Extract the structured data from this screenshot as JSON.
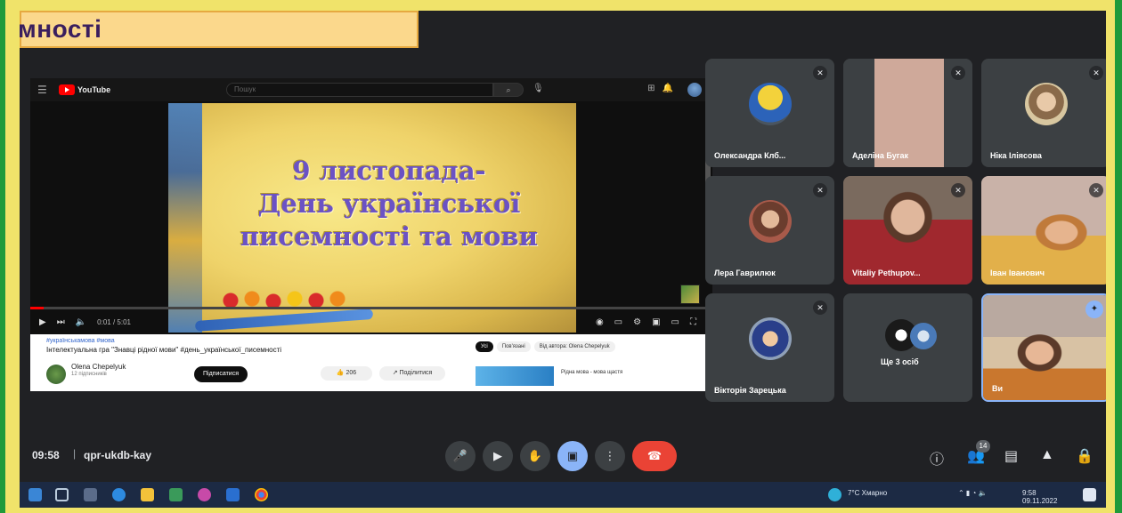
{
  "banner": {
    "text": "мності"
  },
  "youtube": {
    "brand": "YouTube",
    "search_placeholder": "Пошук",
    "slide_title_line1": "9 листопада-",
    "slide_title_line2": "День української",
    "slide_title_line3": "писемності та мови",
    "progress": 0.02,
    "time": "0:01 / 5:01",
    "hashtag": "#українськамова #мова",
    "video_title": "Інтелектуальна гра \"Знавці рідної мови\" #день_української_писемності",
    "channel": "Olena Chepelyuk",
    "channel_sub": "12 підписників",
    "subscribe": "Підписатися",
    "like": "👍 206",
    "share": "↗ Поділитися",
    "chips": [
      "Усі",
      "Пов'язані",
      "Від автора: Olena Chepelyuk"
    ],
    "rec_text": "Рідна мова - мова щастя"
  },
  "participants": [
    {
      "name": "Олександра Клб...",
      "muted": true,
      "avatar": "ukraine-map"
    },
    {
      "name": "Аделіна Бугак",
      "muted": true,
      "avatar": "camera-feed"
    },
    {
      "name": "Ніка Іліясова",
      "muted": true,
      "avatar": "photo"
    },
    {
      "name": "Лера Гаврилюк",
      "muted": true,
      "avatar": "photo"
    },
    {
      "name": "Vitaliy Pethupov...",
      "muted": true,
      "avatar": "camera-feed"
    },
    {
      "name": "Іван Іванович",
      "muted": true,
      "avatar": "camera-feed"
    },
    {
      "name": "Вікторія Зарецька",
      "muted": true,
      "avatar": "photo"
    },
    {
      "name": "Ще 3 осіб",
      "muted": false,
      "avatar": "group"
    },
    {
      "name": "Ви",
      "muted": false,
      "avatar": "camera-feed"
    }
  ],
  "meeting": {
    "time": "09:58",
    "separator": "|",
    "code": "qpr-ukdb-kay",
    "participant_count": "14",
    "end_call_color": "#ea4335",
    "accent": "#8ab4f8"
  },
  "controls": {
    "mic": "mic-icon",
    "camera": "camera-icon",
    "hand": "raise-hand-icon",
    "present": "present-icon",
    "more": "more-icon",
    "end": "end-call-icon"
  },
  "taskbar": {
    "weather": "7°C Хмарно",
    "clock_time": "9:58",
    "clock_date": "09.11.2022"
  }
}
